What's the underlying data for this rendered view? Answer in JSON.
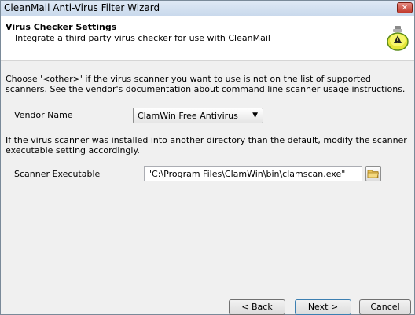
{
  "window": {
    "title": "CleanMail Anti-Virus Filter Wizard",
    "close_label": "✕"
  },
  "header": {
    "title": "Virus Checker Settings",
    "subtitle": "Integrate a third party virus checker for use with CleanMail",
    "icon": "warning-shield-icon"
  },
  "content": {
    "intro_text": "Choose '<other>' if the virus scanner you want to use is not on the list of supported scanners. See the vendor's documentation about command line scanner usage instructions.",
    "vendor_label": "Vendor Name",
    "vendor_selected": "ClamWin Free Antivirus",
    "dir_text": "If the virus scanner was installed into another directory than the default, modify the scanner executable setting accordingly.",
    "scanner_label": "Scanner Executable",
    "scanner_value": "\"C:\\Program Files\\ClamWin\\bin\\clamscan.exe\"",
    "browse_icon": "folder-icon"
  },
  "footer": {
    "back_label": "< Back",
    "next_label": "Next >",
    "cancel_label": "Cancel"
  },
  "colors": {
    "accent": "#3c7fb1",
    "header_bg": "#ffffff",
    "panel_bg": "#f0f0f0"
  }
}
